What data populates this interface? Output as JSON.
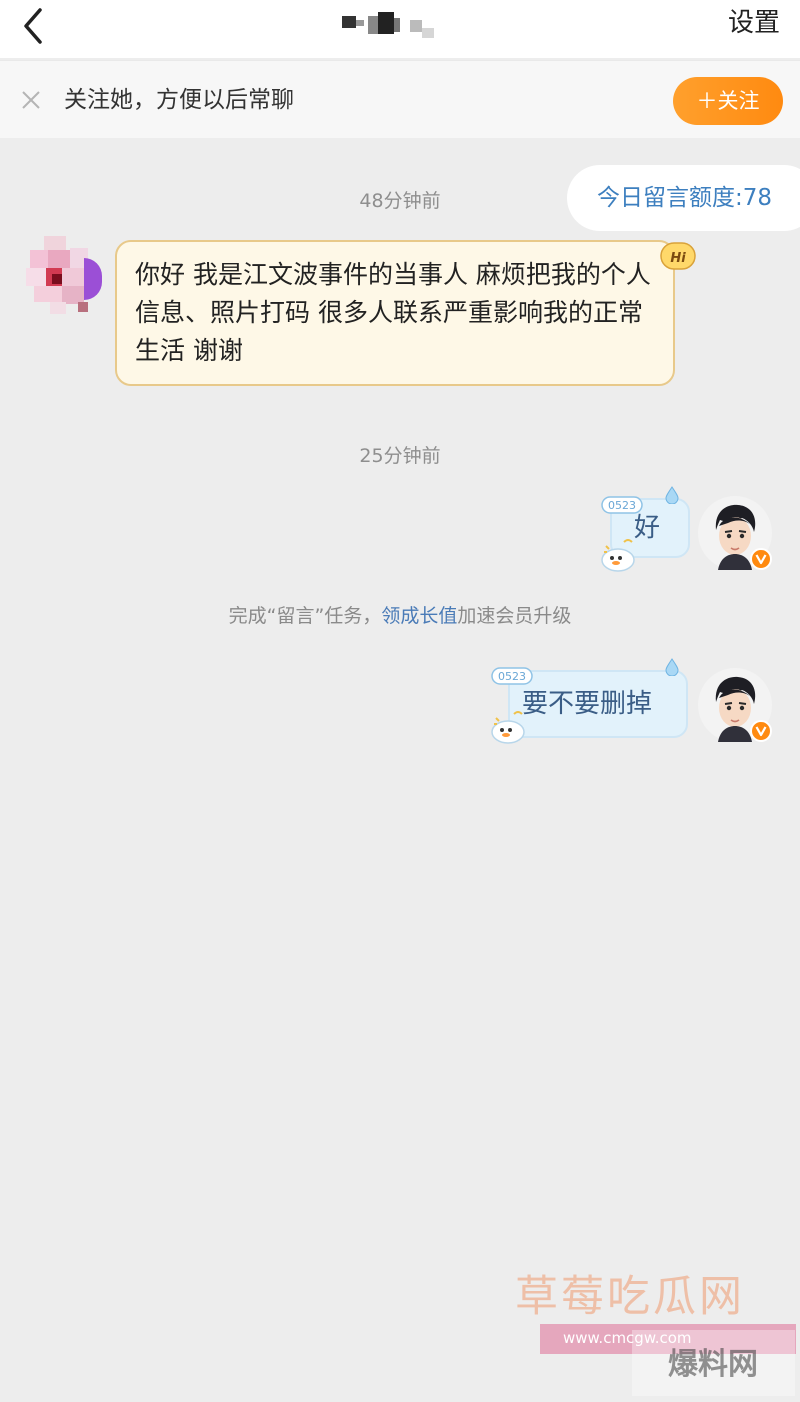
{
  "header": {
    "settings_label": "设置"
  },
  "follow_bar": {
    "hint": "关注她，方便以后常聊",
    "button_label": "＋关注"
  },
  "quota": {
    "label": "今日留言额度:78"
  },
  "messages": [
    {
      "time": "48分钟前",
      "direction": "incoming",
      "text": "你好 我是江文波事件的当事人 麻烦把我的个人信息、照片打码 很多人联系严重影响我的正常生活 谢谢",
      "badge": "Hi"
    },
    {
      "time": "25分钟前",
      "direction": "outgoing",
      "text": "好",
      "sticker_number": "0523"
    },
    {
      "direction": "outgoing",
      "text": "要不要删掉",
      "sticker_number": "0523"
    }
  ],
  "system_tip": {
    "prefix": "完成“留言”任务，",
    "link": "领成长值",
    "suffix": "加速会员升级"
  },
  "watermark": {
    "title": "草莓吃瓜网",
    "url": "www.cmcgw.com",
    "logo": "爆料网"
  },
  "colors": {
    "accent_orange": "#ff8a10",
    "link_blue": "#4a7bb7",
    "incoming_bubble": "#fef8e7",
    "outgoing_bubble": "#e2f2fb",
    "background": "#ededed"
  }
}
